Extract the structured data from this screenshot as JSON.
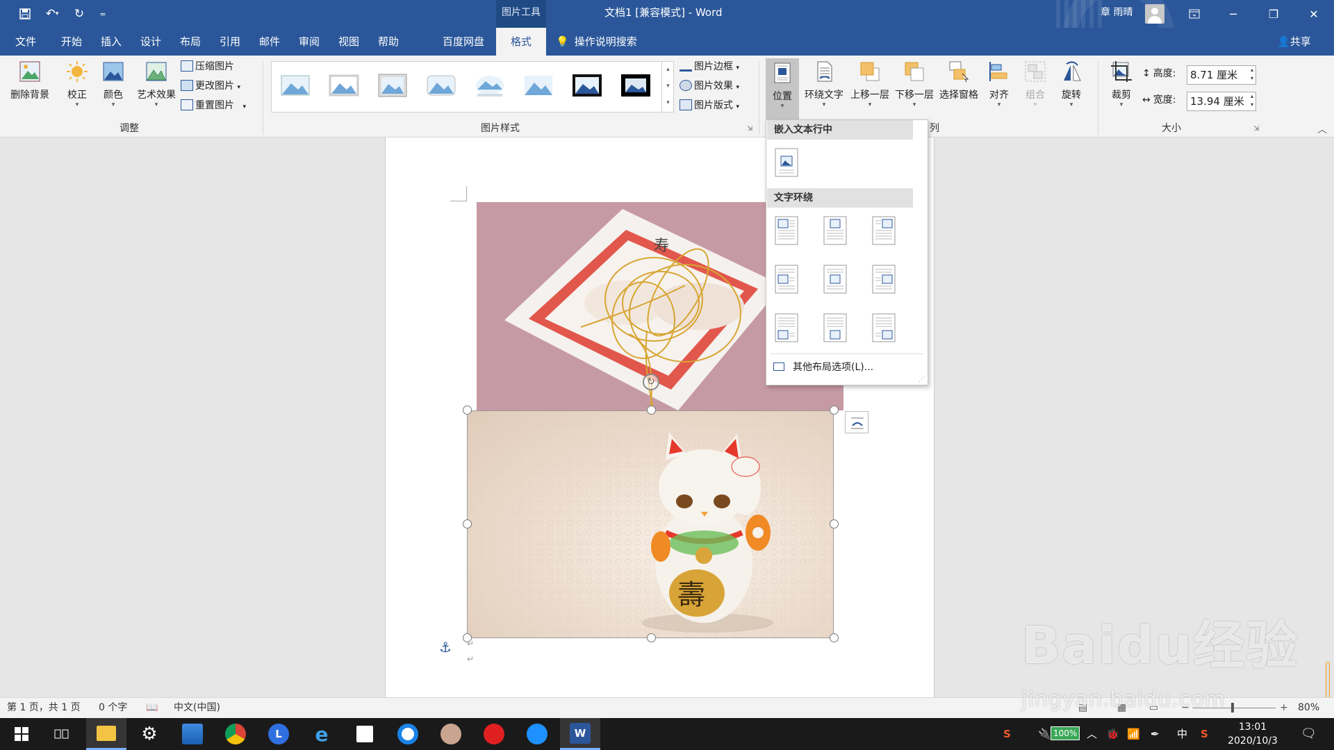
{
  "titlebar": {
    "context_tools": "图片工具",
    "doc_title": "文档1 [兼容模式]  -  Word",
    "user_name": "章 雨晴",
    "qat_more": "="
  },
  "tabs": [
    {
      "label": "文件"
    },
    {
      "label": "开始"
    },
    {
      "label": "插入"
    },
    {
      "label": "设计"
    },
    {
      "label": "布局"
    },
    {
      "label": "引用"
    },
    {
      "label": "邮件"
    },
    {
      "label": "审阅"
    },
    {
      "label": "视图"
    },
    {
      "label": "帮助"
    },
    {
      "label": "百度网盘"
    }
  ],
  "active_tab": "格式",
  "tell_me": "操作说明搜索",
  "share": "共享",
  "ribbon": {
    "adjust": {
      "remove_bg": "删除背景",
      "corrections": "校正",
      "color": "颜色",
      "artistic": "艺术效果",
      "compress": "压缩图片",
      "change": "更改图片",
      "reset": "重置图片",
      "group": "调整"
    },
    "styles": {
      "border": "图片边框",
      "effects": "图片效果",
      "layout": "图片版式",
      "group": "图片样式"
    },
    "arrange": {
      "position": "位置",
      "wrap": "环绕文字",
      "forward": "上移一层",
      "backward": "下移一层",
      "pane": "选择窗格",
      "align": "对齐",
      "group_btn": "组合",
      "rotate": "旋转",
      "group": "列"
    },
    "size": {
      "crop": "裁剪",
      "height_label": "高度:",
      "height_value": "8.71 厘米",
      "width_label": "宽度:",
      "width_value": "13.94 厘米",
      "group": "大小"
    }
  },
  "dropdown": {
    "inline_header": "嵌入文本行中",
    "wrap_header": "文字环绕",
    "more": "其他布局选项(L)..."
  },
  "status": {
    "page": "第 1 页，共 1 页",
    "words": "0 个字",
    "lang": "中文(中国)",
    "zoom": "80%"
  },
  "taskbar": {
    "battery": "100%",
    "ime": "中",
    "time": "13:01",
    "date": "2020/10/3"
  },
  "watermark": {
    "brand": "Baidu经验",
    "url": "jingyan.baidu.com"
  },
  "colors": {
    "word_blue": "#2b579a",
    "ribbon_bg": "#f3f3f3",
    "taskbar": "#1a1a1a"
  }
}
